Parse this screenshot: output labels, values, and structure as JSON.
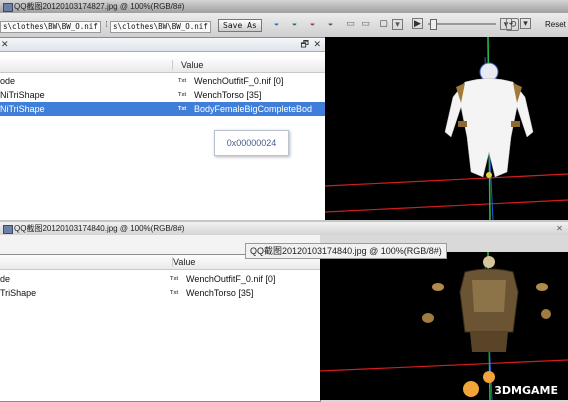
{
  "top_window": {
    "title": "QQ截图20120103174827.jpg @ 100%(RGB/8#)",
    "close": "✕",
    "toolbar": {
      "path_left": "s\\clothes\\BW\\BW_O.nif",
      "path_right": "s\\clothes\\BW\\BW_O.nif",
      "save_as": "Save As",
      "reset": "Reset"
    },
    "panel": {
      "col_value": "Value",
      "rows": [
        {
          "key": "ode",
          "type": "Txt",
          "value": "WenchOutfitF_0.nif [0]"
        },
        {
          "key": "NiTriShape",
          "type": "Txt",
          "value": "WenchTorso [35]"
        },
        {
          "key": "NiTriShape",
          "type": "Txt",
          "value": "BodyFemaleBigCompleteBod"
        }
      ],
      "tooltip": "0x00000024",
      "ctl_pin": "🗗",
      "ctl_close": "✕"
    }
  },
  "bottom_window": {
    "title": "QQ截图20120103174840.jpg @ 100%(RGB/8#)",
    "float_label": "QQ截图20120103174840.jpg @ 100%(RGB/8#)",
    "panel": {
      "col_value": "Value",
      "rows": [
        {
          "key": "de",
          "type": "Txt",
          "value": "WenchOutfitF_0.nif [0]"
        },
        {
          "key": "TriShape",
          "type": "Txt",
          "value": "WenchTorso [35]"
        }
      ]
    }
  },
  "watermark": "3DMGAME",
  "colors": {
    "selection": "#3f7fd9",
    "viewport_bg": "#000000",
    "grid_red": "#d21e1e",
    "axis_green": "#27c24a",
    "axis_blue": "#2c5bd8"
  }
}
